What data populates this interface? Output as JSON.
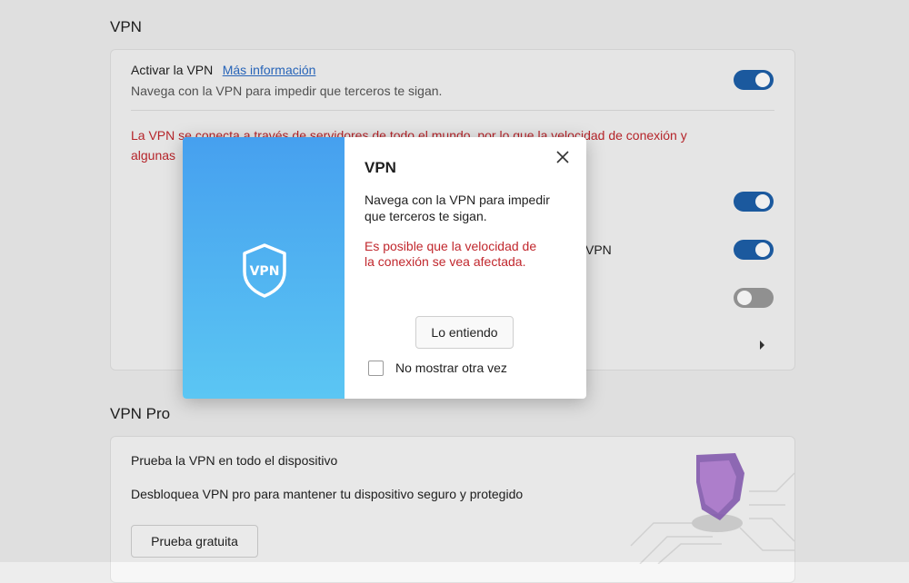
{
  "vpn_section": {
    "title": "VPN",
    "activate_label": "Activar la VPN",
    "more_info_link": "Más información",
    "activate_description": "Navega con la VPN para impedir que terceros te sigan.",
    "warning_line1": "La VPN se conecta a través de servidores de todo el mundo, por lo que la velocidad de conexión y",
    "warning_line2": "algunas",
    "partial_label": "VPN",
    "toggles": [
      true,
      true,
      true,
      false
    ]
  },
  "vpn_pro_section": {
    "title": "VPN Pro",
    "card_title": "Prueba la VPN en todo el dispositivo",
    "card_description": "Desbloquea VPN pro para mantener tu dispositivo seguro y protegido",
    "trial_button": "Prueba gratuita"
  },
  "dialog": {
    "badge_text": "VPN",
    "title": "VPN",
    "body": "Navega con la VPN para impedir que terceros te sigan.",
    "warning": "Es posible que la velocidad de la conexión se vea afectada.",
    "ok_button": "Lo entiendo",
    "dont_show_label": "No mostrar otra vez"
  },
  "colors": {
    "accent": "#1d5fa8",
    "warning": "#c1272d",
    "link": "#2a6bc4",
    "dialog_gradient_top": "#46a0ef",
    "dialog_gradient_bottom": "#5bc6f3"
  },
  "icons": [
    "shield-vpn-icon",
    "close-icon",
    "chevron-right-icon",
    "shield-illustration"
  ]
}
